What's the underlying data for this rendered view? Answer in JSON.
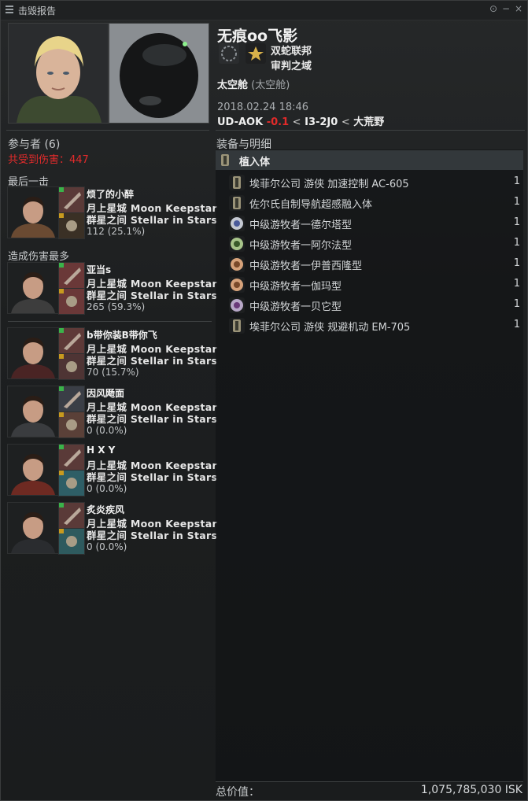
{
  "window": {
    "title": "击毁报告",
    "controls": [
      "⊙",
      "−",
      "×"
    ]
  },
  "victim": {
    "name": "无痕oo飞影",
    "corporation": "双蛇联邦",
    "alliance": "审判之域",
    "ship_name": "太空舱",
    "ship_type": "(太空舱)",
    "timestamp": "2018.02.24 18:46",
    "system": "UD-AOK",
    "security": "-0.1",
    "sep1": "<",
    "constellation": "I3-2J0",
    "sep2": "<",
    "region": "大荒野"
  },
  "left": {
    "participants_label": "参与者 (6)",
    "total_damage": "共受到伤害：447",
    "final_blow_label": "最后一击",
    "top_damage_label": "造成伤害最多"
  },
  "attackers": [
    {
      "name": "烦了的小醉",
      "corp": "月上星城 Moon Keepstar",
      "alliance": "群星之间 Stellar in Stars",
      "damage": "112 (25.1%)",
      "face": "#6a4a32",
      "ship": "#5a3a38",
      "weapon": "#3a3025"
    },
    {
      "name": "亚当s",
      "corp": "月上星城 Moon Keepstar",
      "alliance": "群星之间 Stellar in Stars",
      "damage": "265 (59.3%)",
      "face": "#3d3d3d",
      "ship": "#6a3838",
      "weapon": "#6a3838"
    },
    {
      "name": "b带你装B带你飞",
      "corp": "月上星城 Moon Keepstar",
      "alliance": "群星之间 Stellar in Stars",
      "damage": "70 (15.7%)",
      "face": "#4a2424",
      "ship": "#5e3a38",
      "weapon": "#4e3434"
    },
    {
      "name": "因风飏面",
      "corp": "月上星城 Moon Keepstar",
      "alliance": "群星之间 Stellar in Stars",
      "damage": "0 (0.0%)",
      "face": "#3a3c3f",
      "ship": "#3a3e46",
      "weapon": "#5a4038"
    },
    {
      "name": "H X Y",
      "corp": "月上星城 Moon Keepstar",
      "alliance": "群星之间 Stellar in Stars",
      "damage": "0 (0.0%)",
      "face": "#6e2a22",
      "ship": "#5a3a38",
      "weapon": "#2e5e66"
    },
    {
      "name": "炙炎疾风",
      "corp": "月上星城 Moon Keepstar",
      "alliance": "群星之间 Stellar in Stars",
      "damage": "0 (0.0%)",
      "face": "#2a2c2f",
      "ship": "#5a3a38",
      "weapon": "#2e5a5e"
    }
  ],
  "right": {
    "fittings_label": "装备与明细",
    "section": "植入体",
    "items": [
      {
        "name": "埃菲尔公司 游侠 加速控制 AC-605",
        "qty": "1",
        "icon": "implant"
      },
      {
        "name": "佐尔氏自制导航超感融入体",
        "qty": "1",
        "icon": "implant"
      },
      {
        "name": "中级游牧者一德尔塔型",
        "qty": "1",
        "icon": "orb-a"
      },
      {
        "name": "中级游牧者一阿尔法型",
        "qty": "1",
        "icon": "orb-b"
      },
      {
        "name": "中级游牧者一伊普西隆型",
        "qty": "1",
        "icon": "orb-c"
      },
      {
        "name": "中级游牧者一伽玛型",
        "qty": "1",
        "icon": "orb-c"
      },
      {
        "name": "中级游牧者一贝它型",
        "qty": "1",
        "icon": "orb-d"
      },
      {
        "name": "埃菲尔公司 游侠 规避机动 EM-705",
        "qty": "1",
        "icon": "implant"
      }
    ],
    "total_label": "总价值：",
    "total_value": "1,075,785,030 ISK"
  },
  "colors": {
    "security_red": "#e32a2a",
    "damage_red": "#e22b2b",
    "header_bg": "#33383b"
  }
}
